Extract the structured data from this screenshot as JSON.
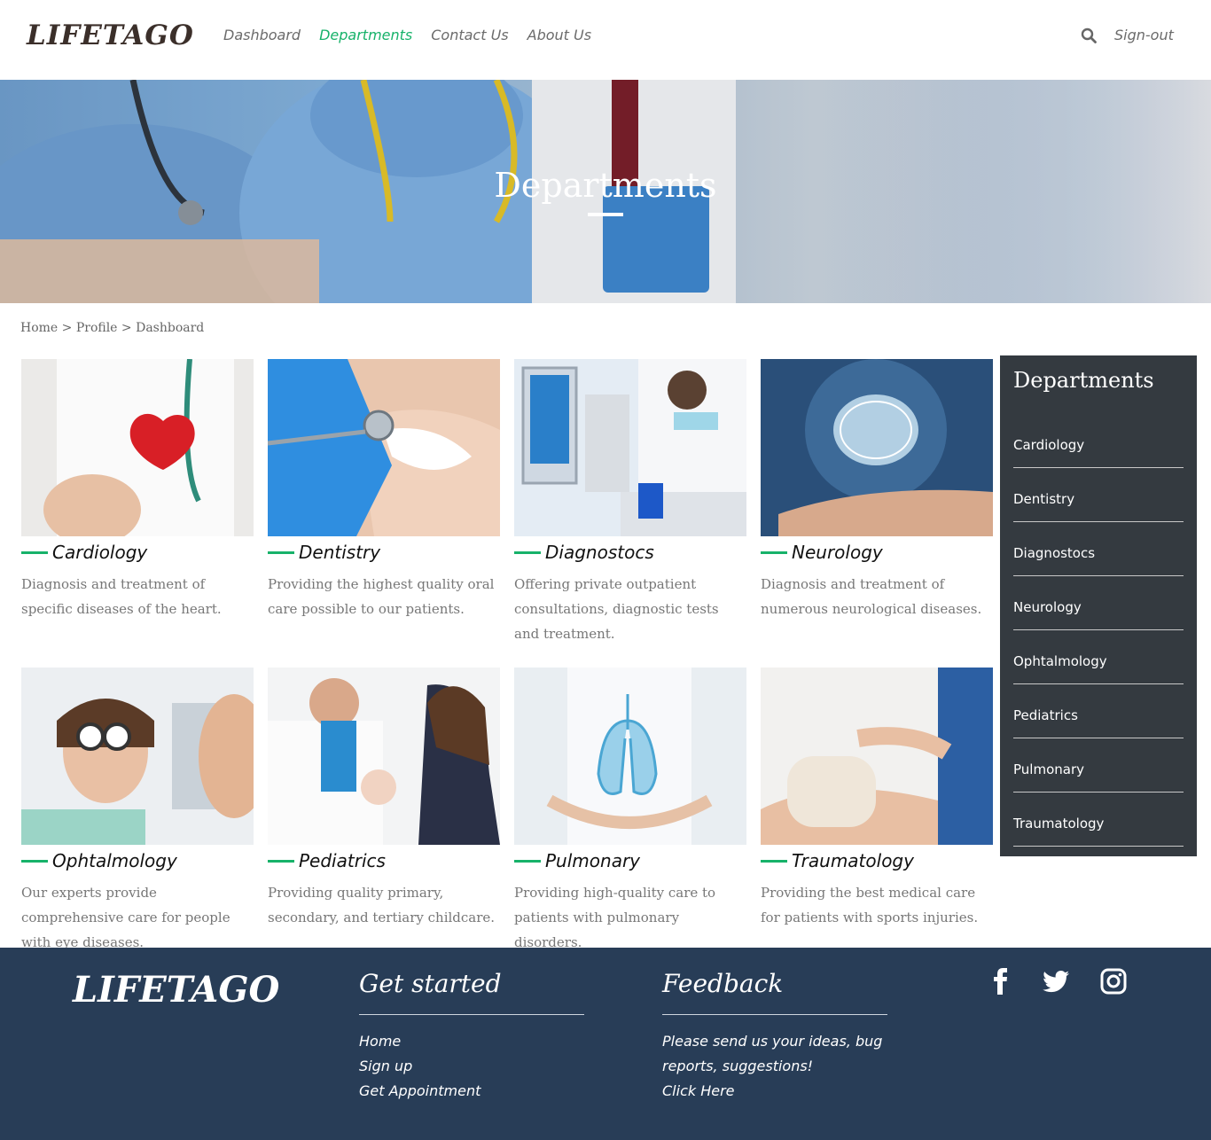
{
  "header": {
    "logo": "LIFETAGO",
    "nav": [
      "Dashboard",
      "Departments",
      "Contact Us",
      "About Us"
    ],
    "active_nav": "Departments",
    "signout": "Sign-out"
  },
  "hero": {
    "title": "Departments"
  },
  "breadcrumb": "Home > Profile > Dashboard",
  "cards": [
    {
      "title": "Cardiology",
      "desc": "Diagnosis and treatment of specific diseases of the heart."
    },
    {
      "title": "Dentistry",
      "desc": "Providing the highest quality oral care possible to our patients."
    },
    {
      "title": "Diagnostocs",
      "desc": "Offering private outpatient consultations, diagnostic tests and treatment."
    },
    {
      "title": "Neurology",
      "desc": "Diagnosis and treatment of numerous neurological diseases."
    },
    {
      "title": "Ophtalmology",
      "desc": "Our experts provide comprehensive care for people with eye diseases."
    },
    {
      "title": "Pediatrics",
      "desc": "Providing quality primary, secondary, and tertiary childcare."
    },
    {
      "title": "Pulmonary",
      "desc": "Providing high-quality care to patients with pulmonary disorders."
    },
    {
      "title": "Traumatology",
      "desc": "Providing the best medical care for patients with sports injuries."
    }
  ],
  "sidebar": {
    "title": "Departments",
    "items": [
      "Cardiology",
      "Dentistry",
      "Diagnostocs",
      "Neurology",
      "Ophtalmology",
      "Pediatrics",
      "Pulmonary",
      "Traumatology"
    ]
  },
  "footer": {
    "logo": "LIFETAGO",
    "get_started": {
      "heading": "Get started",
      "links": [
        "Home",
        "Sign up",
        "Get Appointment"
      ]
    },
    "feedback": {
      "heading": "Feedback",
      "text_line1": "Please send us your ideas, bug",
      "text_line2": "reports, suggestions!",
      "link": "Click Here"
    },
    "social_icons": [
      "facebook-icon",
      "twitter-icon",
      "instagram-icon"
    ]
  },
  "colors": {
    "accent": "#17b26a",
    "sidebar_bg": "#343a40",
    "footer_bg": "#283d57"
  }
}
